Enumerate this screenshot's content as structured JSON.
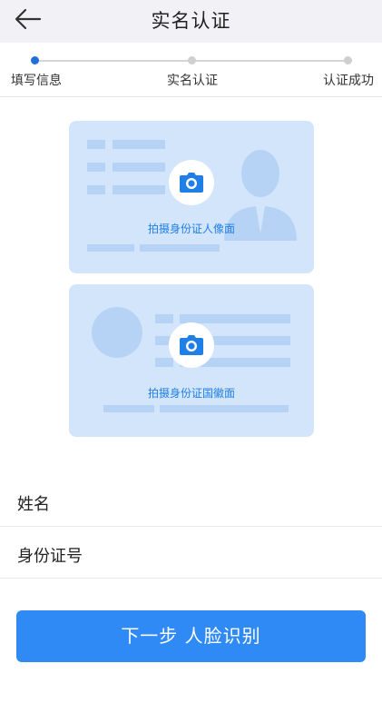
{
  "header": {
    "title": "实名认证",
    "back_icon": "arrow-left-icon"
  },
  "steps": [
    {
      "label": "填写信息",
      "active": true
    },
    {
      "label": "实名认证",
      "active": false
    },
    {
      "label": "认证成功",
      "active": false
    }
  ],
  "cards": {
    "front_caption": "拍摄身份证人像面",
    "back_caption": "拍摄身份证国徽面",
    "camera_icon": "camera-icon"
  },
  "form": {
    "name_label": "姓名",
    "id_label": "身份证号"
  },
  "next_button": "下一步 人脸识别",
  "colors": {
    "accent": "#2f8af5",
    "active_step": "#1e6fd9",
    "card_bg": "#d3e5fb",
    "caption": "#1f7fe6"
  }
}
